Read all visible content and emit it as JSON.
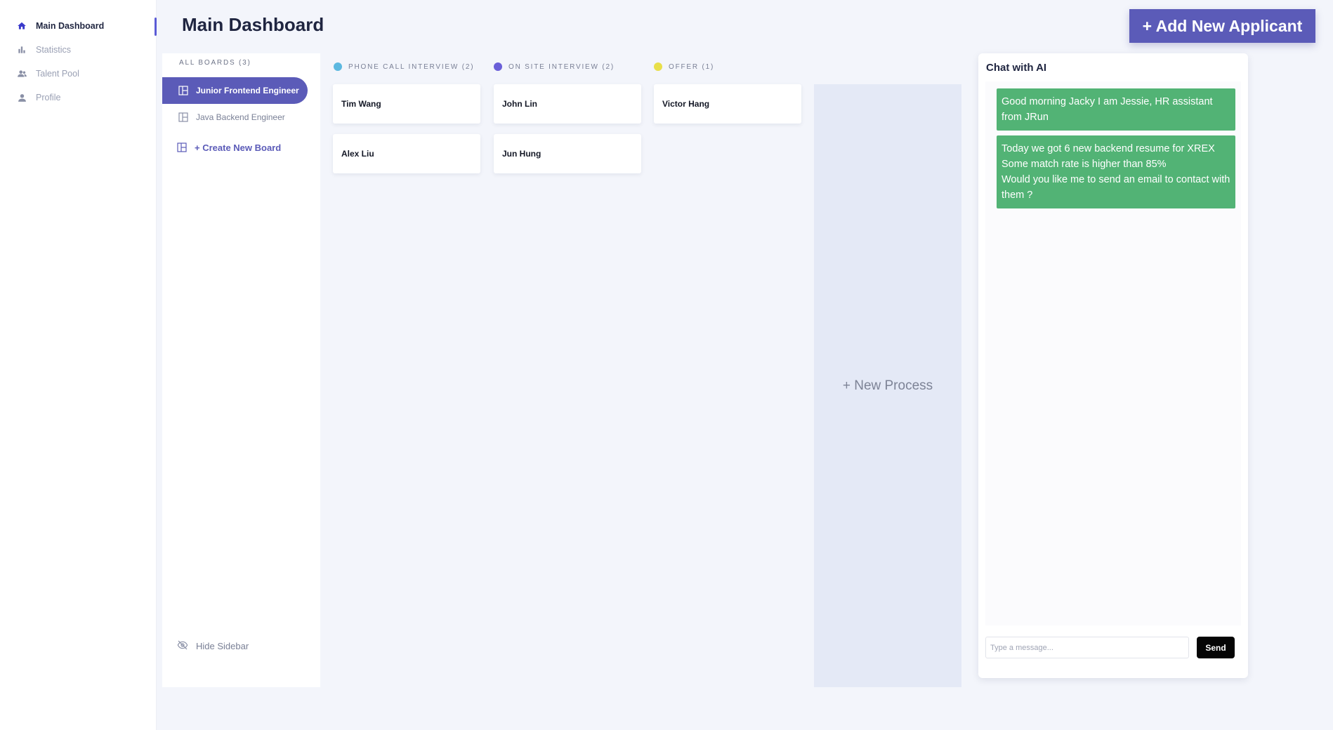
{
  "nav": {
    "items": [
      {
        "label": "Main Dashboard",
        "icon": "home-icon",
        "active": true
      },
      {
        "label": "Statistics",
        "icon": "bar-chart-icon",
        "active": false
      },
      {
        "label": "Talent Pool",
        "icon": "people-icon",
        "active": false
      },
      {
        "label": "Profile",
        "icon": "user-icon",
        "active": false
      }
    ]
  },
  "header": {
    "title": "Main Dashboard",
    "add_button": "+ Add New Applicant"
  },
  "boards": {
    "title": "ALL BOARDS (3)",
    "items": [
      {
        "label": "Junior Frontend Engineer",
        "active": true
      },
      {
        "label": "Java Backend Engineer",
        "active": false
      }
    ],
    "create_label": "+ Create New Board",
    "hide_label": "Hide Sidebar"
  },
  "columns": [
    {
      "label": "PHONE CALL INTERVIEW (2)",
      "color": "#5cb8e0",
      "cards": [
        "Tim Wang",
        "Alex Liu"
      ]
    },
    {
      "label": "ON SITE INTERVIEW (2)",
      "color": "#6a5fd8",
      "cards": [
        "John Lin",
        "Jun Hung"
      ]
    },
    {
      "label": "OFFER (1)",
      "color": "#e8df4a",
      "cards": [
        "Victor Hang"
      ]
    }
  ],
  "new_process": "+ New Process",
  "chat": {
    "title": "Chat with AI",
    "messages": [
      "Good morning Jacky I am Jessie, HR assistant from JRun",
      "Today we got 6 new backend resume for XREX\nSome match rate is higher than 85%\nWould you like me to send an email to contact with them ?"
    ],
    "input_placeholder": "Type a message...",
    "send_label": "Send"
  },
  "colors": {
    "accent": "#5b5bb8",
    "chat_bubble": "#52b375"
  }
}
